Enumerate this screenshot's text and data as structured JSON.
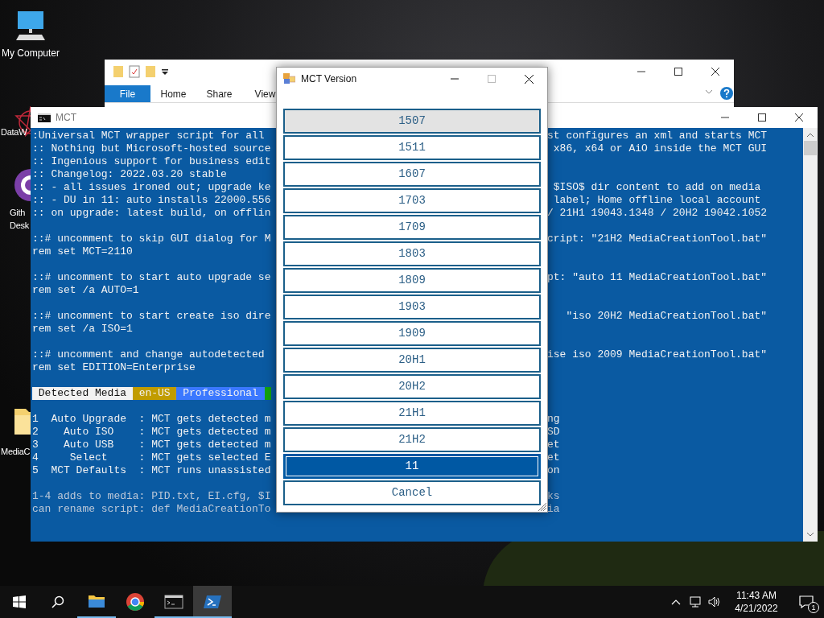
{
  "desktop_icons": [
    {
      "kind": "computer",
      "lines": [
        "My Computer"
      ]
    },
    {
      "kind": "star",
      "lines": [
        "DataW"
      ]
    },
    {
      "kind": "github",
      "lines": [
        "Gith",
        "Desk"
      ]
    },
    {
      "kind": "folder",
      "lines": [
        "MediaC"
      ]
    }
  ],
  "explorer": {
    "tabs": [
      {
        "label": "File",
        "selected": true
      },
      {
        "label": "Home",
        "selected": false
      },
      {
        "label": "Share",
        "selected": false
      },
      {
        "label": "View",
        "selected": false
      }
    ]
  },
  "console": {
    "title": "MCT",
    "rows": [
      {
        "kind": "text",
        "left": ":Universal MCT wrapper script for all",
        "right": "st configures an xml and starts MCT"
      },
      {
        "kind": "text",
        "left": ":: Nothing but Microsoft-hosted source",
        "right": " x86, x64 or AiO inside the MCT GUI"
      },
      {
        "kind": "text",
        "left": ":: Ingenious support for business edit"
      },
      {
        "kind": "text",
        "left": ":: Changelog: 2022.03.20 stable"
      },
      {
        "kind": "text",
        "left": ":: - all issues ironed out; upgrade ke",
        "right": " $ISO$ dir content to add on media"
      },
      {
        "kind": "text",
        "left": ":: - DU in 11: auto installs 22000.556",
        "right": " label; Home offline local account"
      },
      {
        "kind": "text",
        "left": ":: on upgrade: latest build, on offlin",
        "right": "/ 21H1 19043.1348 / 20H2 19042.1052"
      },
      {
        "kind": "blank"
      },
      {
        "kind": "text",
        "left": "::# uncomment to skip GUI dialog for M",
        "right": "cript: \"21H2 MediaCreationTool.bat\""
      },
      {
        "kind": "text",
        "left": "rem set MCT=2110"
      },
      {
        "kind": "blank"
      },
      {
        "kind": "text",
        "left": "::# uncomment to start auto upgrade se",
        "right": "pt: \"auto 11 MediaCreationTool.bat\""
      },
      {
        "kind": "text",
        "left": "rem set /a AUTO=1"
      },
      {
        "kind": "blank"
      },
      {
        "kind": "text",
        "left": "::# uncomment to start create iso dire",
        "right": "   \"iso 20H2 MediaCreationTool.bat\""
      },
      {
        "kind": "text",
        "left": "rem set /a ISO=1"
      },
      {
        "kind": "blank"
      },
      {
        "kind": "text",
        "left": "::# uncomment and change autodetected ",
        "right": "ise iso 2009 MediaCreationTool.bat\""
      },
      {
        "kind": "text",
        "left": "rem set EDITION=Enterprise"
      },
      {
        "kind": "blank"
      },
      {
        "kind": "badges",
        "items": [
          {
            "text": " Detected Media ",
            "color": "#f2f2f2"
          },
          {
            "text": " en-US ",
            "color": "#c19c00"
          },
          {
            "text": " Professional ",
            "color": "#3b78ff"
          },
          {
            "color": "#13a10e"
          }
        ]
      },
      {
        "kind": "blank"
      },
      {
        "kind": "text",
        "left": "1  Auto Upgrade  : MCT gets detected m",
        "right": "ng"
      },
      {
        "kind": "text",
        "left": "2    Auto ISO    : MCT gets detected m",
        "right": "SD"
      },
      {
        "kind": "text",
        "left": "3    Auto USB    : MCT gets detected m",
        "right": "et"
      },
      {
        "kind": "text",
        "left": "4     Select     : MCT gets selected E",
        "right": "et"
      },
      {
        "kind": "text",
        "left": "5  MCT Defaults  : MCT runs unassisted",
        "right": "on"
      },
      {
        "kind": "blank"
      },
      {
        "kind": "text",
        "dim": true,
        "left": "1-4 adds to media: PID.txt, EI.cfg, $I",
        "right": "ks"
      },
      {
        "kind": "text",
        "dim": true,
        "left": "can rename script: def MediaCreationTo",
        "right": "ia"
      }
    ]
  },
  "dialog": {
    "title": "MCT Version",
    "versions": [
      {
        "label": "1507",
        "selected": false,
        "hovered": true
      },
      {
        "label": "1511",
        "selected": false,
        "hovered": false
      },
      {
        "label": "1607",
        "selected": false,
        "hovered": false
      },
      {
        "label": "1703",
        "selected": false,
        "hovered": false
      },
      {
        "label": "1709",
        "selected": false,
        "hovered": false
      },
      {
        "label": "1803",
        "selected": false,
        "hovered": false
      },
      {
        "label": "1809",
        "selected": false,
        "hovered": false
      },
      {
        "label": "1903",
        "selected": false,
        "hovered": false
      },
      {
        "label": "1909",
        "selected": false,
        "hovered": false
      },
      {
        "label": "20H1",
        "selected": false,
        "hovered": false
      },
      {
        "label": "20H2",
        "selected": false,
        "hovered": false
      },
      {
        "label": "21H1",
        "selected": false,
        "hovered": false
      },
      {
        "label": "21H2",
        "selected": false,
        "hovered": false
      },
      {
        "label": "11",
        "selected": true,
        "hovered": false
      }
    ],
    "cancel": "Cancel"
  },
  "taskbar": {
    "apps": [
      {
        "kind": "explorer",
        "running": true,
        "active": false
      },
      {
        "kind": "chrome",
        "running": false,
        "active": false
      },
      {
        "kind": "cmd",
        "running": true,
        "active": false
      },
      {
        "kind": "powershell",
        "running": true,
        "active": true
      }
    ],
    "time": "11:43 AM",
    "date": "4/21/2022",
    "notifications": "1"
  }
}
